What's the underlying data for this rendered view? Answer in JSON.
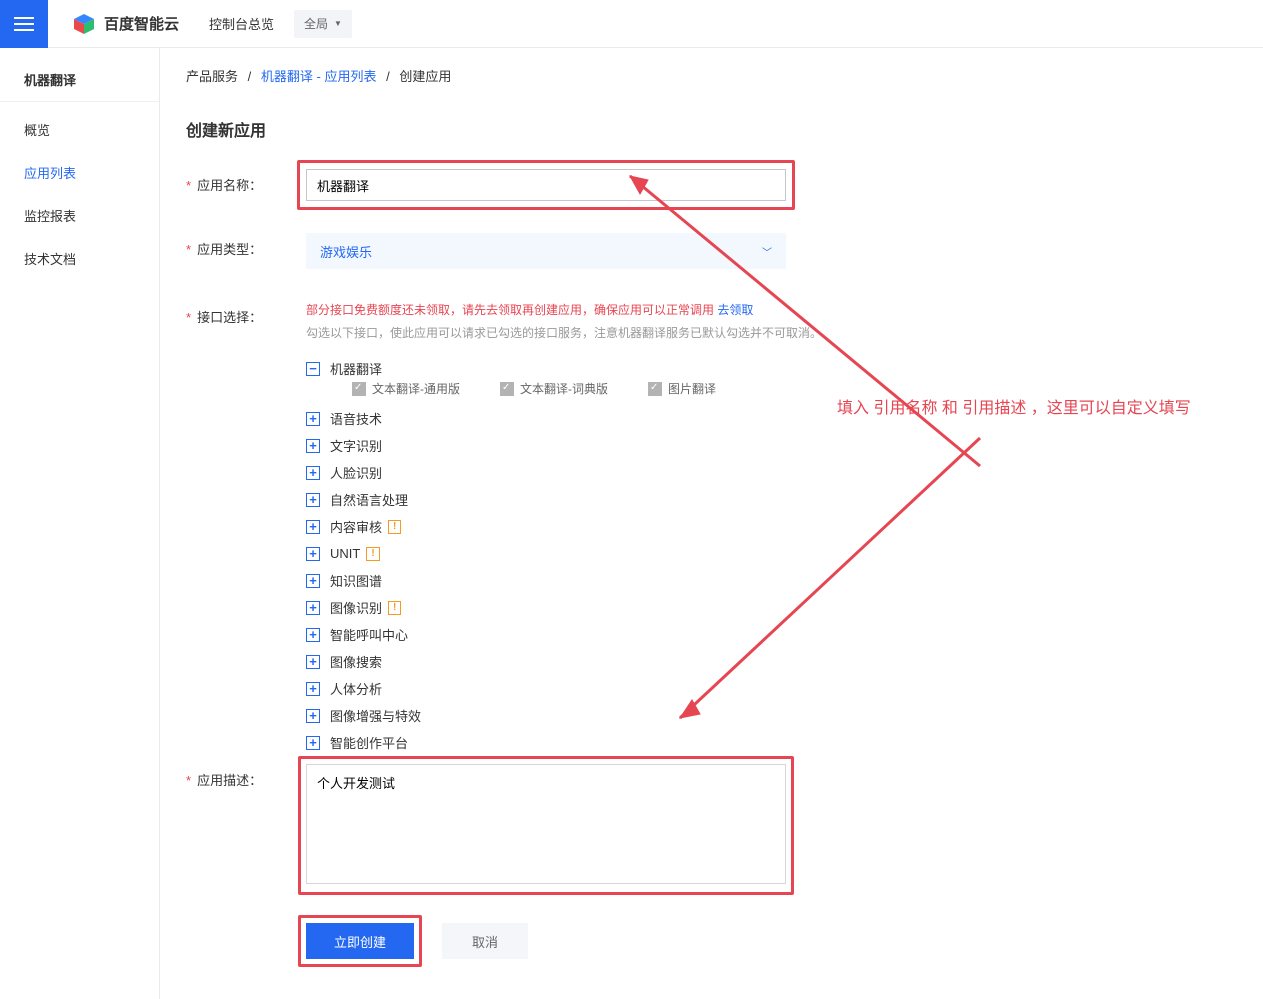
{
  "header": {
    "brand": "百度智能云",
    "console": "控制台总览",
    "scope": "全局"
  },
  "sidebar": {
    "title": "机器翻译",
    "items": [
      {
        "label": "概览",
        "active": false
      },
      {
        "label": "应用列表",
        "active": true
      },
      {
        "label": "监控报表",
        "active": false
      },
      {
        "label": "技术文档",
        "active": false
      }
    ]
  },
  "breadcrumb": {
    "a": "产品服务",
    "b": "机器翻译 - 应用列表",
    "c": "创建应用"
  },
  "page": {
    "heading": "创建新应用"
  },
  "form": {
    "name_label": "应用名称：",
    "name_value": "机器翻译",
    "type_label": "应用类型：",
    "type_value": "游戏娱乐",
    "iface_label": "接口选择：",
    "iface_warn_a": "部分接口免费额度还未领取，请先去领取再创建应用，确保应用可以正常调用 ",
    "iface_warn_link": "去领取",
    "iface_help": "勾选以下接口，使此应用可以请求已勾选的接口服务，注意机器翻译服务已默认勾选并不可取消。",
    "tree_expanded": "机器翻译",
    "checks": [
      "文本翻译-通用版",
      "文本翻译-词典版",
      "图片翻译"
    ],
    "tree_items": [
      {
        "label": "语音技术",
        "badge": false
      },
      {
        "label": "文字识别",
        "badge": false
      },
      {
        "label": "人脸识别",
        "badge": false
      },
      {
        "label": "自然语言处理",
        "badge": false
      },
      {
        "label": "内容审核",
        "badge": true
      },
      {
        "label": "UNIT",
        "badge": true
      },
      {
        "label": "知识图谱",
        "badge": false
      },
      {
        "label": "图像识别",
        "badge": true
      },
      {
        "label": "智能呼叫中心",
        "badge": false
      },
      {
        "label": "图像搜索",
        "badge": false
      },
      {
        "label": "人体分析",
        "badge": false
      },
      {
        "label": "图像增强与特效",
        "badge": false
      },
      {
        "label": "智能创作平台",
        "badge": false
      }
    ],
    "desc_label": "应用描述：",
    "desc_value": "个人开发测试",
    "submit": "立即创建",
    "cancel": "取消"
  },
  "annotation": "填入 引用名称 和 引用描述 ，这里可以自定义填写"
}
